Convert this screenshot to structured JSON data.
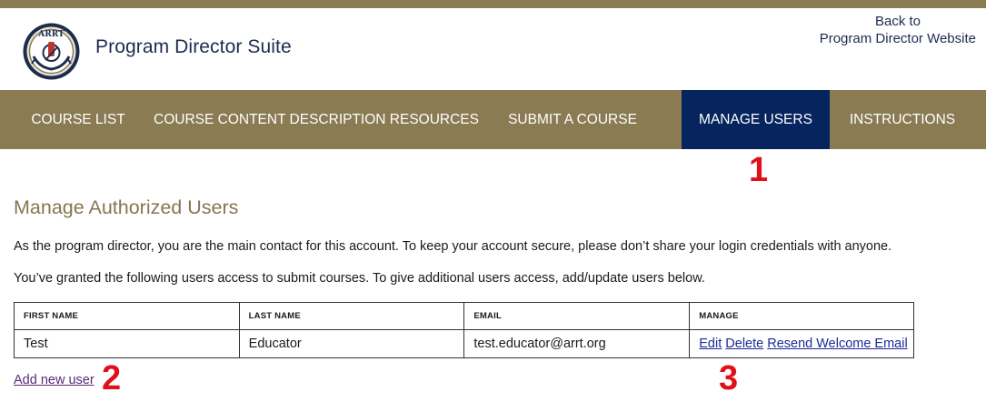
{
  "header": {
    "suite_title": "Program Director Suite",
    "logo_text": "ARRT",
    "back_line1": "Back to",
    "back_line2": "Program Director Website"
  },
  "nav": {
    "items": [
      {
        "label": "COURSE LIST",
        "active": false
      },
      {
        "label": "COURSE CONTENT DESCRIPTION RESOURCES",
        "active": false
      },
      {
        "label": "SUBMIT A COURSE",
        "active": false
      },
      {
        "label": "MANAGE USERS",
        "active": true
      },
      {
        "label": "INSTRUCTIONS",
        "active": false
      }
    ]
  },
  "annotations": [
    "1",
    "2",
    "3"
  ],
  "main": {
    "heading": "Manage Authorized Users",
    "paragraph1": "As the program director, you are the main contact for this account. To keep your account secure, please don’t share your login credentials with anyone.",
    "paragraph2": "You’ve granted the following users access to submit courses. To give additional users access, add/update users below.",
    "table": {
      "headers": [
        "FIRST NAME",
        "LAST NAME",
        "EMAIL",
        "MANAGE"
      ],
      "rows": [
        {
          "first_name": "Test",
          "last_name": "Educator",
          "email": "test.educator@arrt.org"
        }
      ],
      "actions": {
        "edit": "Edit",
        "delete": "Delete",
        "resend": "Resend Welcome Email"
      }
    },
    "add_user_label": "Add new user"
  },
  "colors": {
    "brand_gold": "#8a7b53",
    "nav_active": "#06245d",
    "heading": "#857652",
    "annotation_red": "#e0101a",
    "link_blue": "#1d2b9a"
  }
}
